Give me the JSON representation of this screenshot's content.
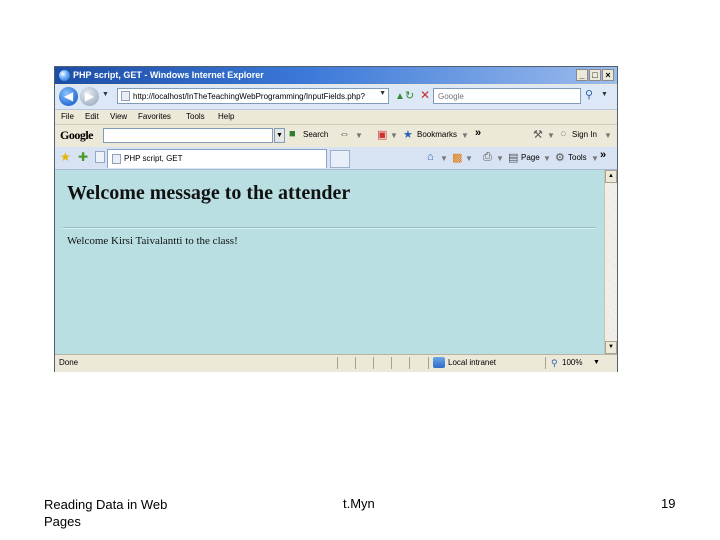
{
  "window": {
    "title": "PHP script, GET - Windows Internet Explorer",
    "minimize": "_",
    "maximize": "□",
    "close": "×"
  },
  "address_bar": {
    "url": "http://localhost/InTheTeachingWebProgramming/InputFields.php?f",
    "search_placeholder": "Google"
  },
  "menu": {
    "items": [
      "File",
      "Edit",
      "View",
      "Favorites",
      "Tools",
      "Help"
    ]
  },
  "google_toolbar": {
    "logo": "Google",
    "search_label": "Search",
    "bookmarks_label": "Bookmarks",
    "more": "»",
    "signin_label": "Sign In"
  },
  "tabs": {
    "active_title": "PHP script, GET"
  },
  "command_bar": {
    "more": "»",
    "page_label": "Page",
    "tools_label": "Tools"
  },
  "content": {
    "heading": "Welcome message to the attender",
    "message": "Welcome Kirsi Taivalantti to the class!"
  },
  "status_bar": {
    "status": "Done",
    "zone": "Local intranet",
    "zoom": "100%"
  },
  "footer": {
    "left": "Reading Data in Web Pages",
    "center": "t.Myn",
    "page_number": "19"
  },
  "colors": {
    "content_background": "#b9dfe3",
    "titlebar": "#1c4ea6"
  }
}
